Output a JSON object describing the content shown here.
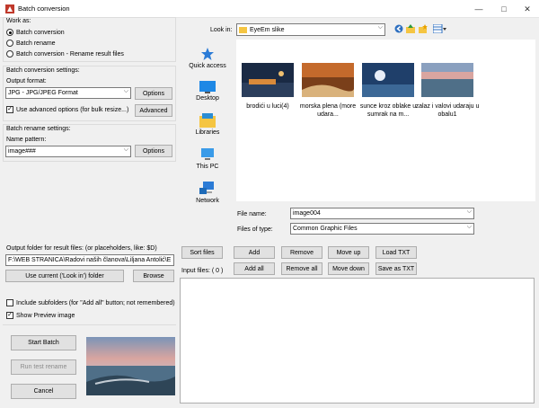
{
  "window": {
    "title": "Batch conversion",
    "minimize": "—",
    "maximize": "□",
    "close": "✕"
  },
  "work_as": {
    "label": "Work as:",
    "options": [
      {
        "label": "Batch conversion",
        "selected": true
      },
      {
        "label": "Batch rename",
        "selected": false
      },
      {
        "label": "Batch conversion - Rename result files",
        "selected": false
      }
    ]
  },
  "conversion_settings": {
    "label": "Batch conversion settings:",
    "output_format_label": "Output format:",
    "output_format": "JPG - JPG/JPEG Format",
    "options_button": "Options",
    "advanced_checkbox": "Use advanced options (for bulk resize...)",
    "advanced_checked": true,
    "advanced_button": "Advanced"
  },
  "rename_settings": {
    "label": "Batch rename settings:",
    "pattern_label": "Name pattern:",
    "pattern": "image###",
    "options_button": "Options"
  },
  "output_folder": {
    "label": "Output folder for result files: (or placeholders, like: $D)",
    "path": "F:\\WEB STRANICA\\Radovi naših članova\\Liljana Antolić\\E",
    "use_current_button": "Use current ('Look in') folder",
    "browse_button": "Browse"
  },
  "include_subfolders": {
    "label": "Include subfolders (for \"Add all\" button; not remembered)",
    "checked": false
  },
  "show_preview": {
    "label": "Show Preview image",
    "checked": true
  },
  "actions": {
    "start": "Start Batch",
    "run_test": "Run test rename",
    "cancel": "Cancel"
  },
  "browser": {
    "look_in_label": "Look in:",
    "look_in_value": "EyeEm slike",
    "places": [
      "Quick access",
      "Desktop",
      "Libraries",
      "This PC",
      "Network"
    ],
    "files": [
      {
        "caption": "brodići u luci(4)"
      },
      {
        "caption": "morska plena (more udara..."
      },
      {
        "caption": "sunce kroz oblake u sumrak na m..."
      },
      {
        "caption": "zalaz i valovi udaraju u obalu1"
      }
    ],
    "file_name_label": "File name:",
    "file_name": "image004",
    "file_type_label": "Files of type:",
    "file_type": "Common Graphic Files"
  },
  "list_buttons": {
    "sort": "Sort files",
    "add": "Add",
    "remove": "Remove",
    "move_up": "Move up",
    "load_txt": "Load TXT",
    "add_all": "Add all",
    "remove_all": "Remove all",
    "move_down": "Move down",
    "save_txt": "Save as TXT"
  },
  "input_files_label": "Input files: ( 0 )",
  "colors": {
    "accent": "#0078d7",
    "folder": "#f5c542"
  },
  "icons": [
    "back-icon",
    "up-folder-icon",
    "new-folder-icon",
    "view-menu-icon",
    "star-icon",
    "desktop-icon",
    "libraries-icon",
    "pc-icon",
    "network-icon"
  ]
}
